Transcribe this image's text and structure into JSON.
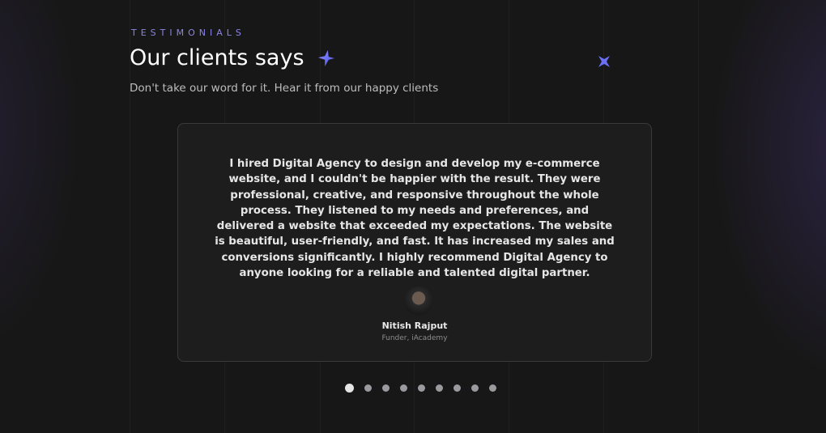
{
  "section": {
    "eyebrow": "TESTIMONIALS",
    "title": "Our clients says",
    "subtitle": "Don't take our word for it. Hear it from our happy clients"
  },
  "testimonial": {
    "quote": "I hired Digital Agency to design and develop my e-commerce website, and I couldn't be happier with the result. They were professional, creative, and responsive throughout the whole process. They listened to my needs and preferences, and delivered a website that exceeded my expectations. The website is beautiful, user-friendly, and fast. It has increased my sales and conversions significantly. I highly recommend Digital Agency to anyone looking for a reliable and talented digital partner.",
    "name": "Nitish Rajput",
    "role": "Funder, iAcademy"
  },
  "pagination": {
    "total": 9,
    "active": 1
  },
  "colors": {
    "accent": "#8b84e8",
    "star": "#6b6ff5"
  }
}
